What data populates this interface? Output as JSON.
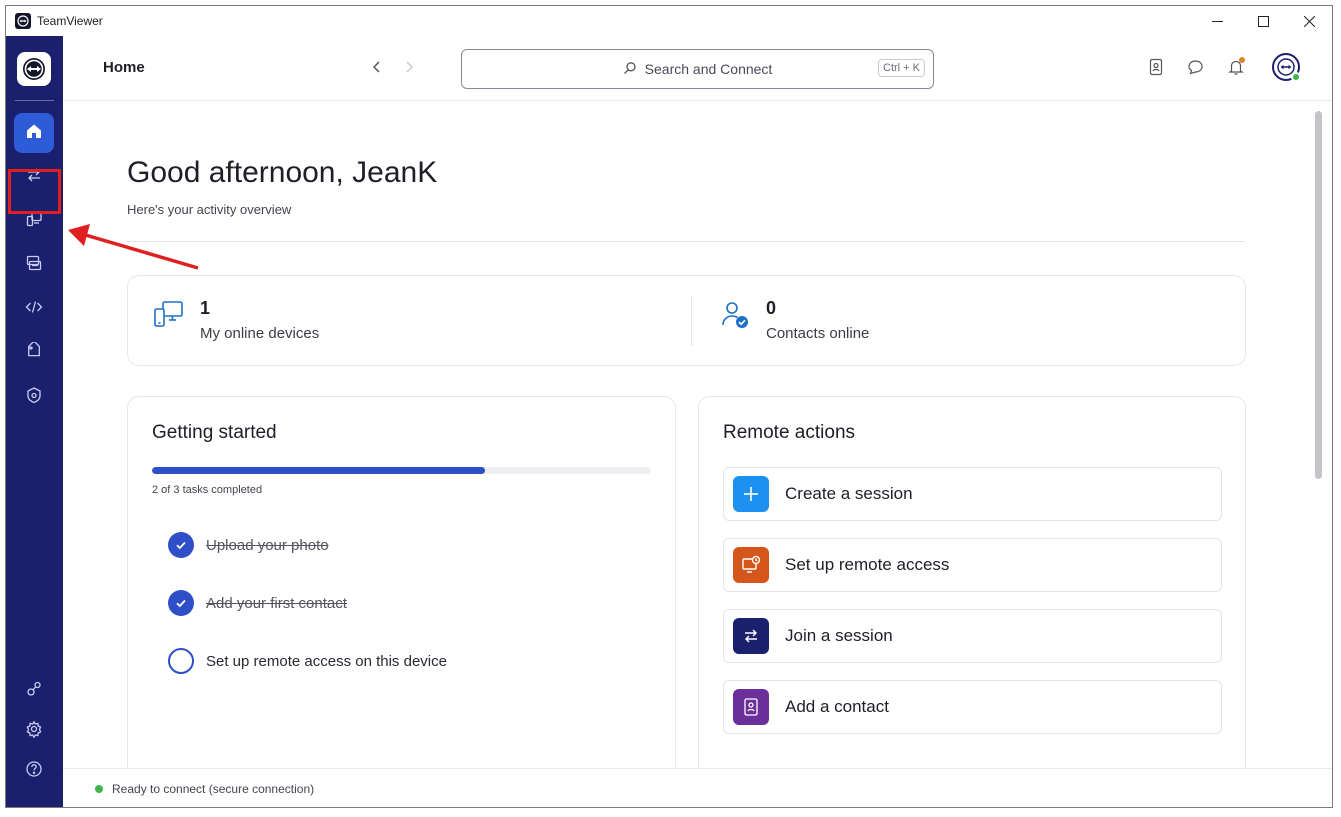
{
  "window": {
    "title": "TeamViewer"
  },
  "header": {
    "page_title": "Home",
    "search": {
      "placeholder": "Search and Connect",
      "shortcut": "Ctrl + K"
    }
  },
  "greeting": {
    "title": "Good afternoon, JeanK",
    "subtitle": "Here's your activity overview"
  },
  "stats": [
    {
      "value": "1",
      "label": "My online devices"
    },
    {
      "value": "0",
      "label": "Contacts online"
    }
  ],
  "getting_started": {
    "title": "Getting started",
    "progress_fraction": 0.667,
    "progress_text": "2 of 3 tasks completed",
    "tasks": [
      {
        "label": "Upload your photo",
        "done": true
      },
      {
        "label": "Add your first contact",
        "done": true
      },
      {
        "label": "Set up remote access on this device",
        "done": false
      }
    ]
  },
  "remote_actions": {
    "title": "Remote actions",
    "items": [
      {
        "label": "Create a session",
        "icon": "plus-icon",
        "color": "#1e90f0"
      },
      {
        "label": "Set up remote access",
        "icon": "monitor-clock-icon",
        "color": "#d5561a"
      },
      {
        "label": "Join a session",
        "icon": "swap-arrows-icon",
        "color": "#1a1f6e"
      },
      {
        "label": "Add a contact",
        "icon": "contact-book-icon",
        "color": "#6b2f9a"
      }
    ]
  },
  "status": {
    "text": "Ready to connect (secure connection)"
  },
  "colors": {
    "rail": "#1a1f6e",
    "accent": "#2e4fc8",
    "annotation": "#e02020",
    "online": "#3fb449"
  }
}
